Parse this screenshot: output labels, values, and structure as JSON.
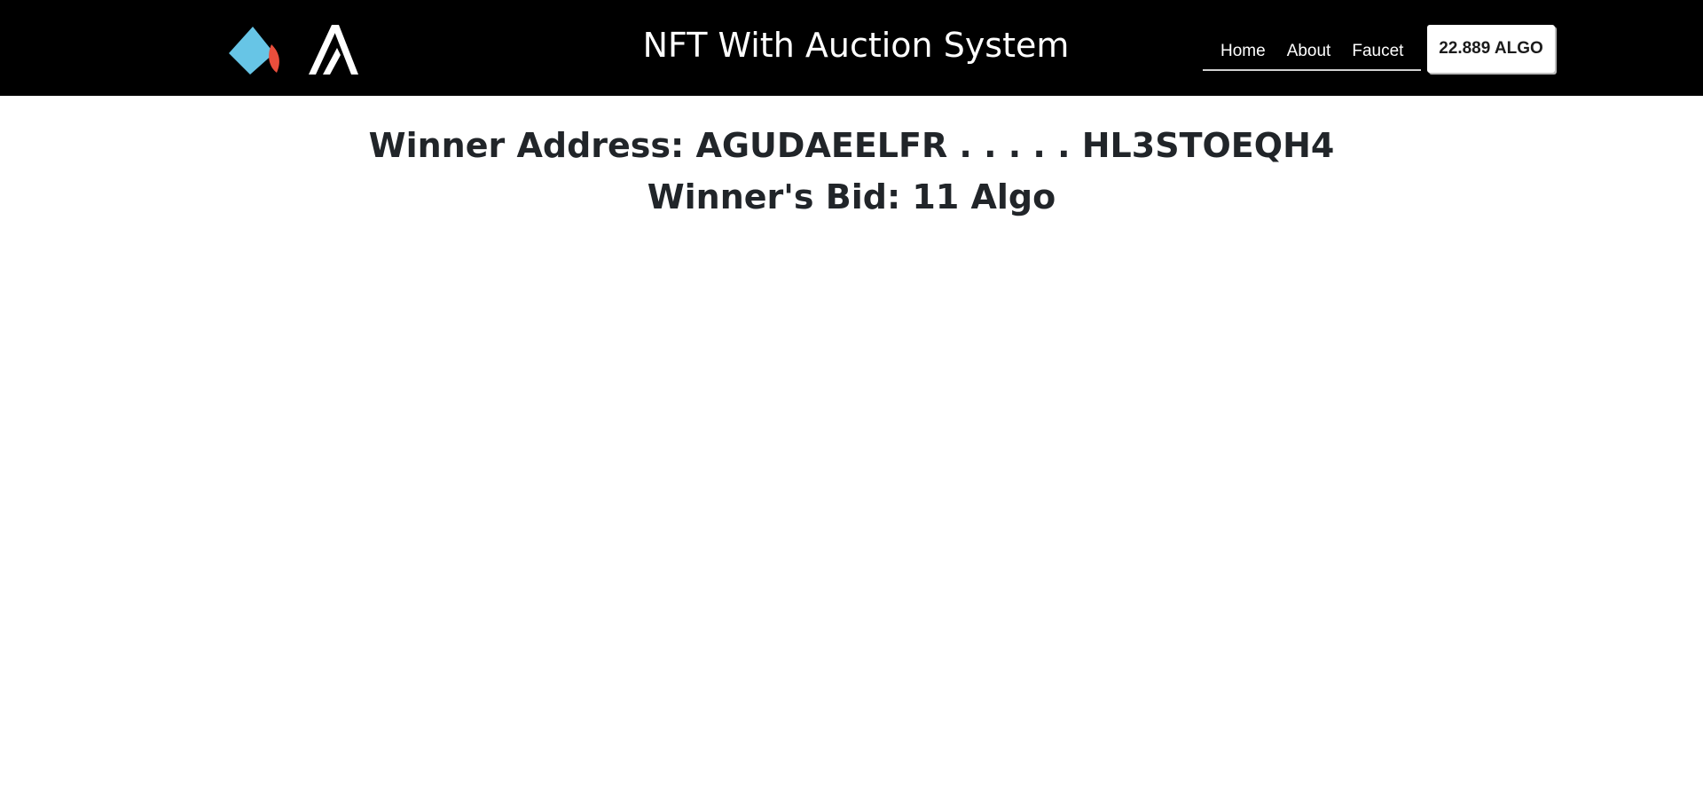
{
  "header": {
    "logos": [
      "auction-logo-icon",
      "algorand-logo-icon"
    ],
    "title": "NFT With Auction System",
    "nav": [
      {
        "label": "Home"
      },
      {
        "label": "About"
      },
      {
        "label": "Faucet"
      }
    ],
    "balance": "22.889 ALGO"
  },
  "main": {
    "winner_address": "Winner Address: AGUDAEELFR . . . . . HL3STOEQH4",
    "winner_bid": "Winner's Bid: 11 Algo"
  },
  "colors": {
    "navbar_bg": "#000000",
    "logo_blue": "#67c5e6",
    "logo_red": "#e94e3c",
    "text_dark": "#212529"
  }
}
